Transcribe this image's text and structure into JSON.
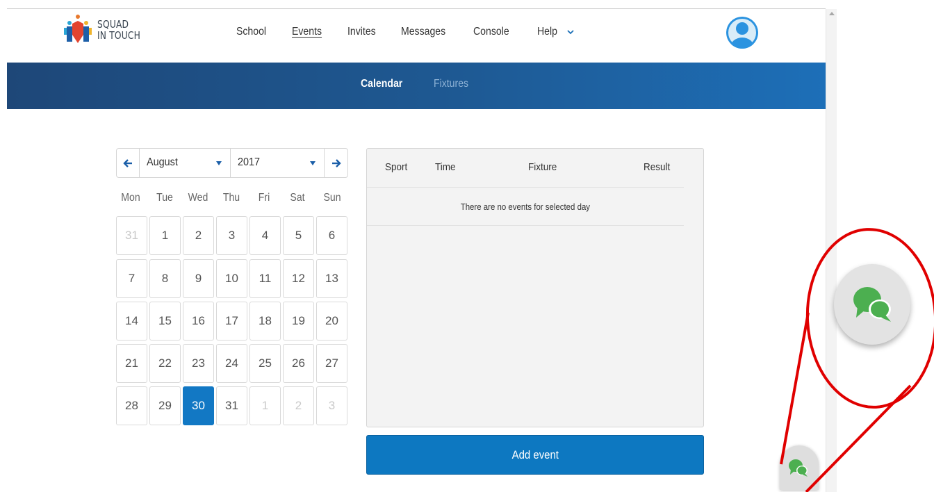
{
  "header": {
    "logo_line1": "SQUAD",
    "logo_line2": "IN TOUCH",
    "nav": [
      {
        "label": "School",
        "active": false
      },
      {
        "label": "Events",
        "active": true
      },
      {
        "label": "Invites",
        "active": false
      },
      {
        "label": "Messages",
        "active": false
      },
      {
        "label": "Console",
        "active": false
      }
    ],
    "help_label": "Help"
  },
  "subnav": {
    "items": [
      {
        "label": "Calendar",
        "active": true
      },
      {
        "label": "Fixtures",
        "active": false
      }
    ]
  },
  "calendar": {
    "month": "August",
    "year": "2017",
    "weekdays": [
      "Mon",
      "Tue",
      "Wed",
      "Thu",
      "Fri",
      "Sat",
      "Sun"
    ],
    "weeks": [
      [
        "31",
        "1",
        "2",
        "3",
        "4",
        "5",
        "6"
      ],
      [
        "7",
        "8",
        "9",
        "10",
        "11",
        "12",
        "13"
      ],
      [
        "14",
        "15",
        "16",
        "17",
        "18",
        "19",
        "20"
      ],
      [
        "21",
        "22",
        "23",
        "24",
        "25",
        "26",
        "27"
      ],
      [
        "28",
        "29",
        "30",
        "31",
        "1",
        "2",
        "3"
      ]
    ],
    "selected_day": "30"
  },
  "events": {
    "columns": [
      "Sport",
      "Time",
      "Fixture",
      "Result"
    ],
    "empty_message": "There are no events for selected day",
    "add_button": "Add event"
  },
  "colors": {
    "accent": "#1278c4",
    "header_gradient_start": "#1e4778",
    "header_gradient_end": "#1d6fb8",
    "chat_icon": "#4caf50",
    "annotation": "#e00000"
  },
  "icons": {
    "prev": "arrow-left-icon",
    "next": "arrow-right-icon",
    "help_toggle": "chevron-down-icon",
    "chat": "chat-bubbles-icon",
    "profile": "user-avatar-icon"
  }
}
